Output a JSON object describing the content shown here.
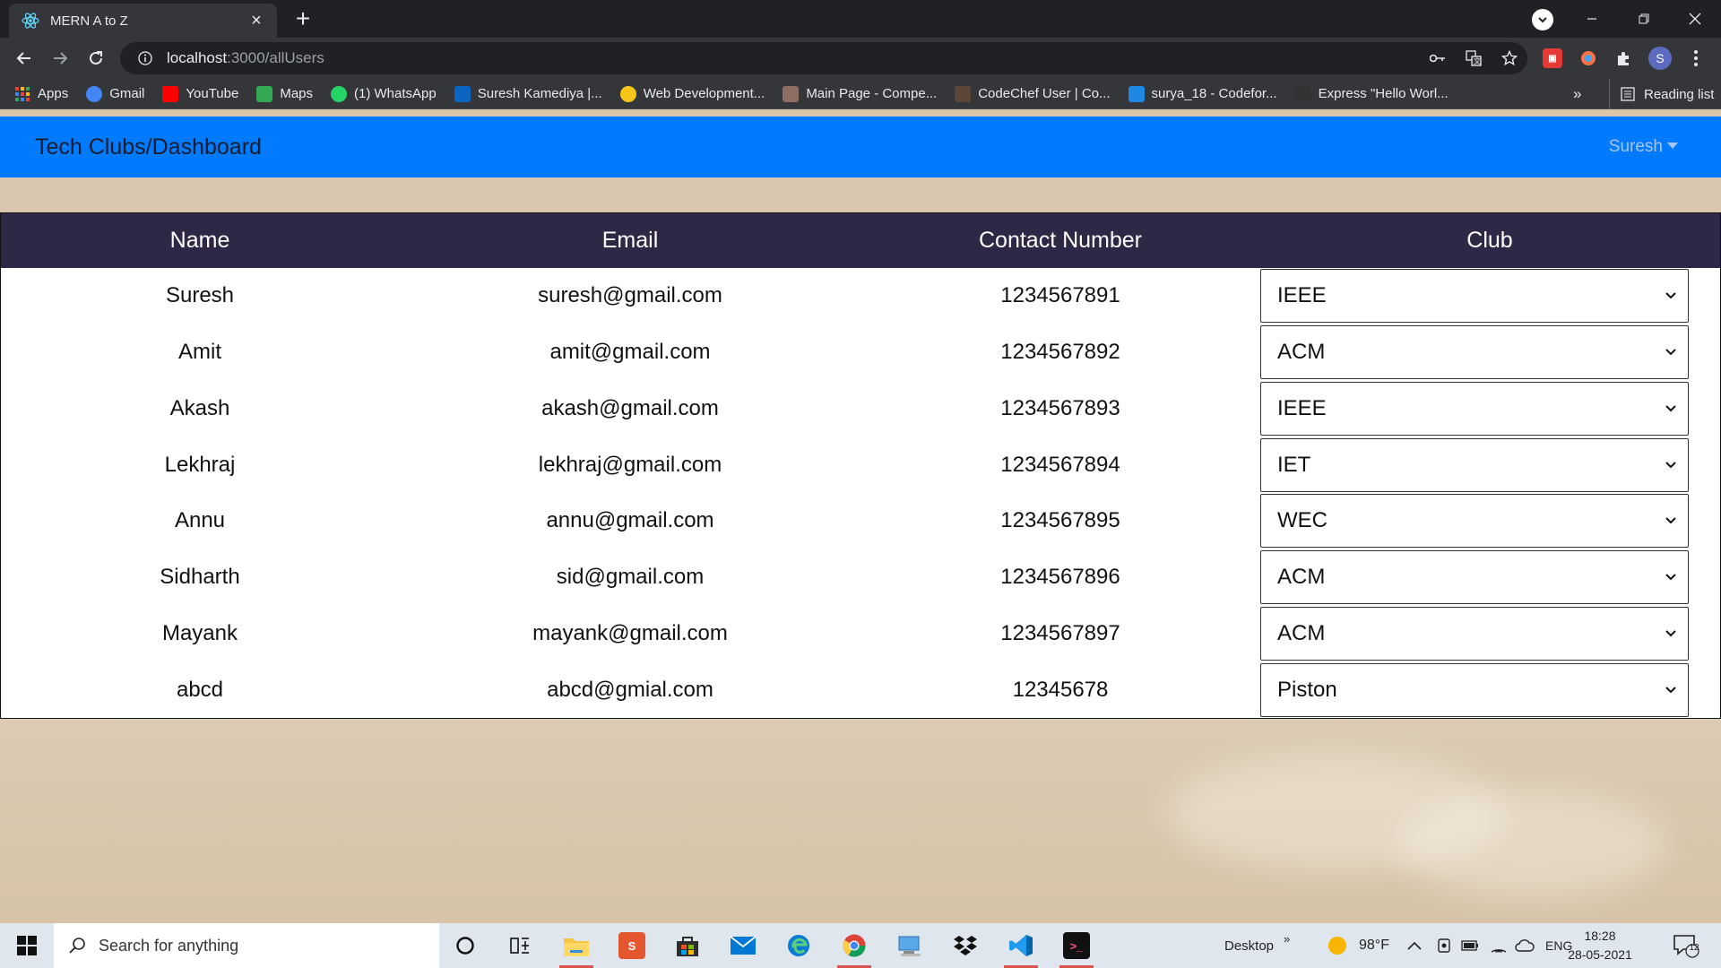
{
  "browser": {
    "tab_title": "MERN A to Z",
    "url_host": "localhost",
    "url_path": ":3000/allUsers",
    "bookmarks": [
      {
        "label": "Apps",
        "icon": "apps-grid-icon",
        "color": "#e8eaed"
      },
      {
        "label": "Gmail",
        "icon": "google-icon",
        "color": "#4285f4"
      },
      {
        "label": "YouTube",
        "icon": "youtube-icon",
        "color": "#ff0000"
      },
      {
        "label": "Maps",
        "icon": "maps-pin-icon",
        "color": "#34a853"
      },
      {
        "label": "(1) WhatsApp",
        "icon": "whatsapp-icon",
        "color": "#25d366"
      },
      {
        "label": "Suresh Kamediya |...",
        "icon": "linkedin-icon",
        "color": "#0a66c2"
      },
      {
        "label": "Web Development...",
        "icon": "bookmark-site-icon",
        "color": "#f5c518"
      },
      {
        "label": "Main Page - Compe...",
        "icon": "chef-icon",
        "color": "#8d6e63"
      },
      {
        "label": "CodeChef User | Co...",
        "icon": "codechef-icon",
        "color": "#5b4638"
      },
      {
        "label": "surya_18 - Codefor...",
        "icon": "codeforces-icon",
        "color": "#1e88e5"
      },
      {
        "label": "Express \"Hello Worl...",
        "icon": "express-icon",
        "color": "#333333"
      }
    ],
    "bookmarks_more": "»",
    "reading_list": "Reading list",
    "profile_initial": "S"
  },
  "app": {
    "brand": "Tech Clubs/Dashboard",
    "user_menu": "Suresh",
    "nav_color": "#007bff",
    "header_color": "#2e2846"
  },
  "table": {
    "columns": [
      "Name",
      "Email",
      "Contact Number",
      "Club"
    ],
    "rows": [
      {
        "name": "Suresh",
        "email": "suresh@gmail.com",
        "contact": "1234567891",
        "club": "IEEE"
      },
      {
        "name": "Amit",
        "email": "amit@gmail.com",
        "contact": "1234567892",
        "club": "ACM"
      },
      {
        "name": "Akash",
        "email": "akash@gmail.com",
        "contact": "1234567893",
        "club": "IEEE"
      },
      {
        "name": "Lekhraj",
        "email": "lekhraj@gmail.com",
        "contact": "1234567894",
        "club": "IET"
      },
      {
        "name": "Annu",
        "email": "annu@gmail.com",
        "contact": "1234567895",
        "club": "WEC"
      },
      {
        "name": "Sidharth",
        "email": "sid@gmail.com",
        "contact": "1234567896",
        "club": "ACM"
      },
      {
        "name": "Mayank",
        "email": "mayank@gmail.com",
        "contact": "1234567897",
        "club": "ACM"
      },
      {
        "name": "abcd",
        "email": "abcd@gmial.com",
        "contact": "12345678",
        "club": "Piston"
      }
    ]
  },
  "taskbar": {
    "search_placeholder": "Search for anything",
    "desktop_label": "Desktop",
    "desktop_chevron": "»",
    "weather": "98°F",
    "language": "ENG",
    "time": "18:28",
    "date": "28-05-2021",
    "notification_count": "12"
  }
}
